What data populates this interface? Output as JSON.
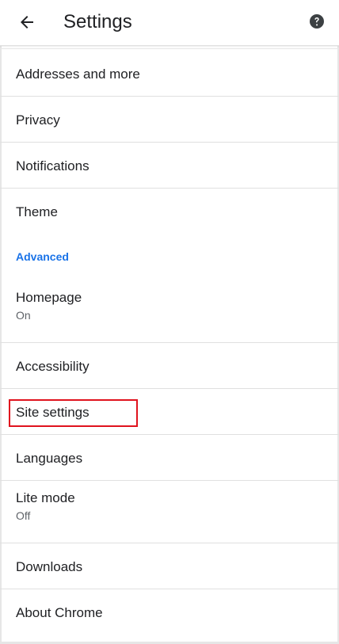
{
  "appbar": {
    "title": "Settings",
    "back_icon": "arrow-left-icon",
    "help_icon": "help-circle-icon"
  },
  "items": [
    {
      "label": "Addresses and more"
    },
    {
      "label": "Privacy"
    },
    {
      "label": "Notifications"
    },
    {
      "label": "Theme"
    }
  ],
  "advanced": {
    "label": "Advanced"
  },
  "homepage": {
    "label": "Homepage",
    "sub": "On"
  },
  "accessibility": {
    "label": "Accessibility"
  },
  "site_settings": {
    "label": "Site settings",
    "highlighted": true
  },
  "languages": {
    "label": "Languages"
  },
  "lite_mode": {
    "label": "Lite mode",
    "sub": "Off"
  },
  "downloads": {
    "label": "Downloads"
  },
  "about_chrome": {
    "label": "About Chrome"
  },
  "colors": {
    "accent": "#1a73e8",
    "text": "#202124",
    "secondary_text": "#5f6368",
    "highlight": "#e0131e",
    "divider": "#e0e0e0"
  }
}
